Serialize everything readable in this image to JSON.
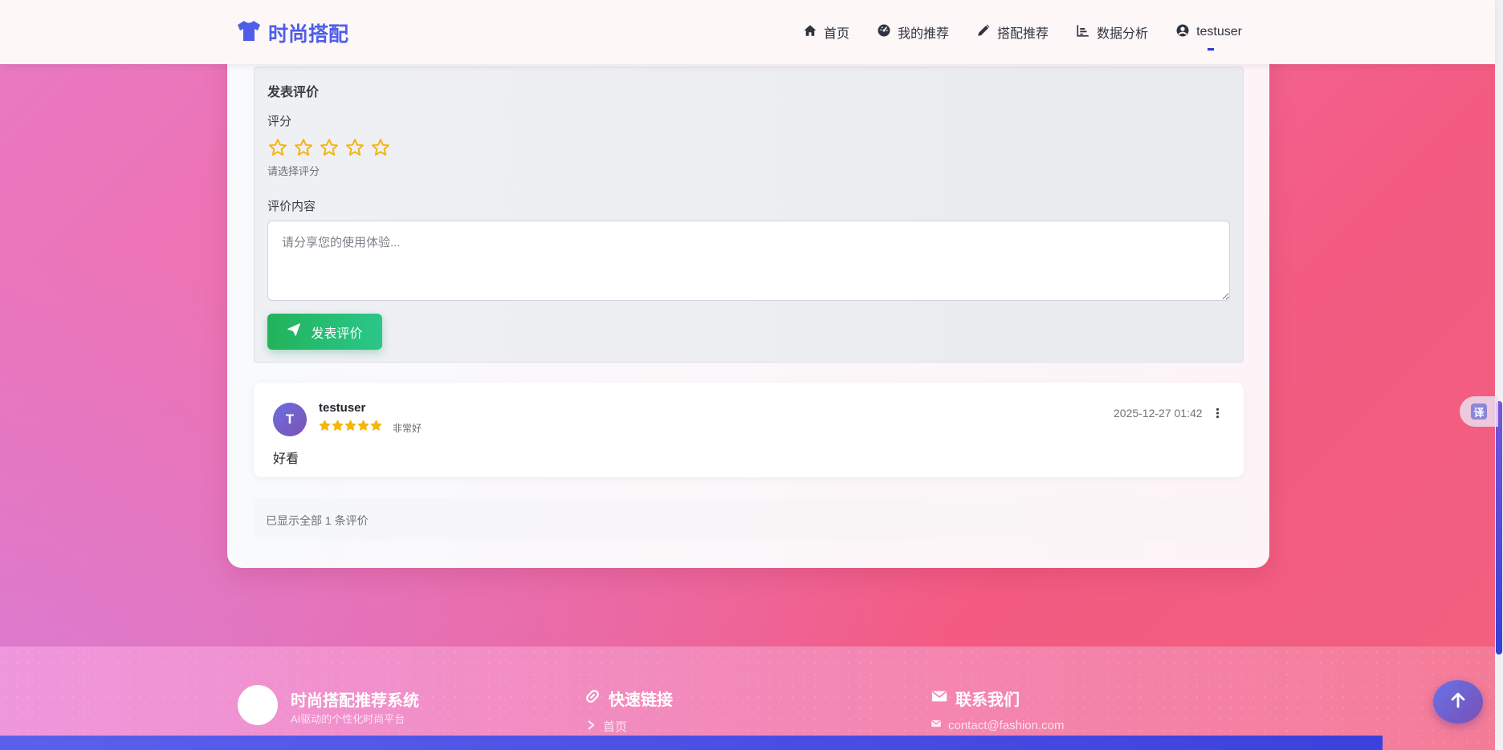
{
  "navbar": {
    "brand": "时尚搭配",
    "items": [
      {
        "label": "首页",
        "icon": "home-icon"
      },
      {
        "label": "我的推荐",
        "icon": "dashboard-icon"
      },
      {
        "label": "搭配推荐",
        "icon": "pencil-icon"
      },
      {
        "label": "数据分析",
        "icon": "chart-icon"
      },
      {
        "label": "testuser",
        "icon": "user-circle-icon"
      }
    ]
  },
  "review_form": {
    "title": "发表评价",
    "rating_label": "评分",
    "rating_hint": "请选择评分",
    "content_label": "评价内容",
    "content_placeholder": "请分享您的使用体验...",
    "content_value": "",
    "submit_label": "发表评价",
    "star_count": 5,
    "selected_rating": 0
  },
  "reviews": [
    {
      "avatar_letter": "T",
      "user": "testuser",
      "rating": 5,
      "rating_text": "非常好",
      "date": "2025-12-27 01:42",
      "content": "好看"
    }
  ],
  "reviews_summary": "已显示全部 1 条评价",
  "footer": {
    "title": "时尚搭配推荐系统",
    "subtitle": "AI驱动的个性化时尚平台",
    "quick_links_title": "快速链接",
    "quick_links": [
      "首页"
    ],
    "contact_title": "联系我们",
    "contact_email": "contact@fashion.com"
  },
  "widgets": {
    "translate_label": "译",
    "page_scroll_progress": 0.925
  },
  "colors": {
    "brand": "#4f5ee6",
    "star": "#f5b50a",
    "submit": "#22b35a",
    "avatar": "#6c6ee0"
  }
}
